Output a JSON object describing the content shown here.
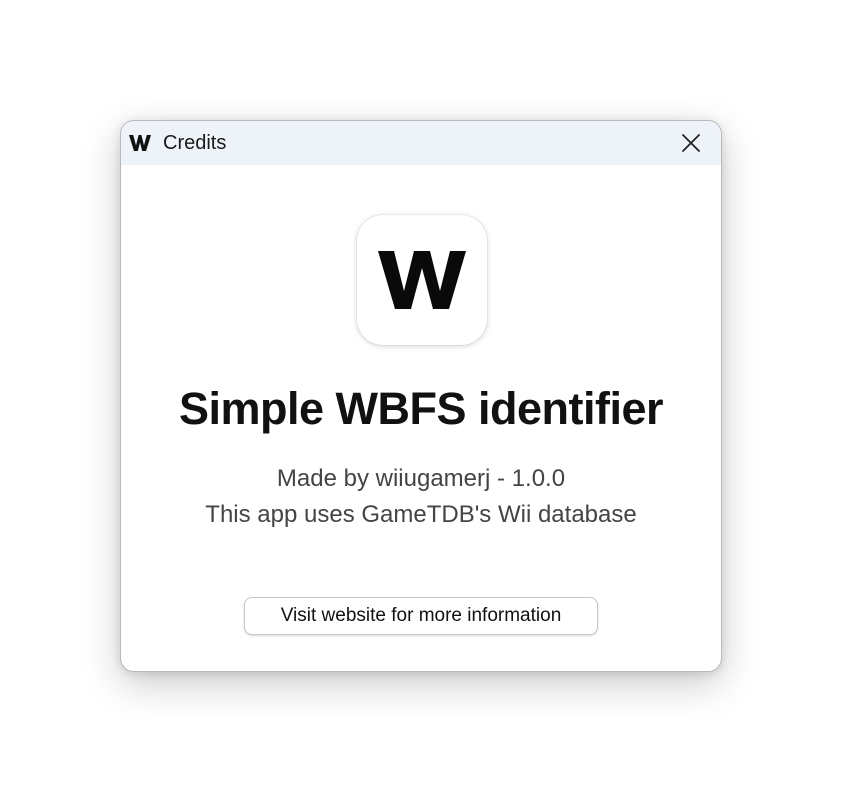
{
  "window": {
    "title": "Credits",
    "title_icon": "app-w-logo-icon",
    "close_icon": "close-icon"
  },
  "app": {
    "logo_letter": "W",
    "name": "Simple WBFS identifier",
    "made_by": "Made by wiiugamerj - 1.0.0",
    "database_note": "This app uses GameTDB's Wii database"
  },
  "actions": {
    "website_button_label": "Visit website for more information"
  },
  "colors": {
    "titlebar_bg": "#eef3fa",
    "window_bg": "#ffffff",
    "title_text": "#111111",
    "info_text": "#444444"
  }
}
